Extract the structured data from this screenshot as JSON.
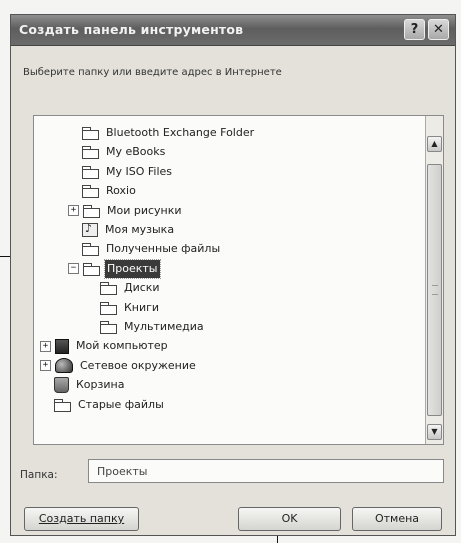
{
  "dialog": {
    "title": "Создать панель инструментов",
    "help_button": "?",
    "close_button": "✕",
    "instruction": "Выберите папку или введите адрес в Интернете"
  },
  "tree": {
    "items": [
      {
        "label": "Bluetooth Exchange Folder",
        "icon": "folder-icon"
      },
      {
        "label": "My eBooks",
        "icon": "folder-icon"
      },
      {
        "label": "My ISO Files",
        "icon": "folder-icon"
      },
      {
        "label": "Roxio",
        "icon": "folder-icon"
      },
      {
        "label": "Мои рисунки",
        "icon": "folder-icon",
        "expander": "+"
      },
      {
        "label": "Моя музыка",
        "icon": "music-folder-icon"
      },
      {
        "label": "Полученные файлы",
        "icon": "folder-icon"
      },
      {
        "label": "Проекты",
        "icon": "folder-icon",
        "expander": "−",
        "selected": true
      },
      {
        "label": "Диски",
        "icon": "folder-icon"
      },
      {
        "label": "Книги",
        "icon": "folder-icon"
      },
      {
        "label": "Мультимедиа",
        "icon": "folder-icon"
      },
      {
        "label": "Мой компьютер",
        "icon": "computer-icon",
        "expander": "+"
      },
      {
        "label": "Сетевое окружение",
        "icon": "network-icon",
        "expander": "+"
      },
      {
        "label": "Корзина",
        "icon": "recycle-bin-icon"
      },
      {
        "label": "Старые файлы",
        "icon": "folder-icon"
      }
    ]
  },
  "scrollbar": {
    "up": "▲",
    "down": "▼"
  },
  "folder_field": {
    "label": "Папка:",
    "value": "Проекты"
  },
  "buttons": {
    "new_folder": "Создать папку",
    "ok": "OK",
    "cancel": "Отмена"
  }
}
